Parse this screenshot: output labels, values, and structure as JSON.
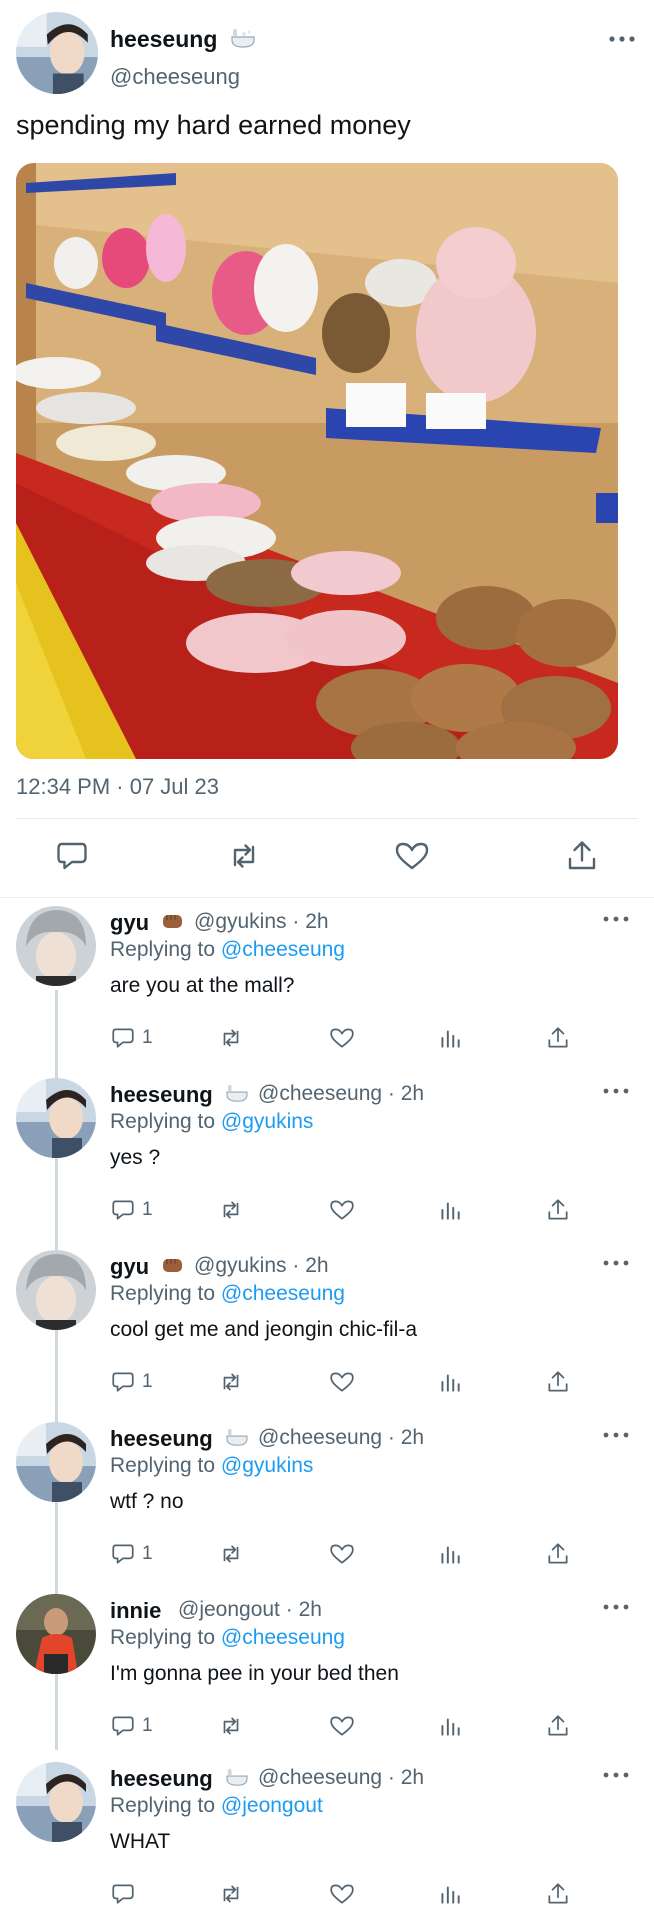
{
  "main_tweet": {
    "author_name": "heeseung",
    "author_handle": "@cheeseung",
    "text": "spending my hard earned money",
    "timestamp": "12:34 PM · 07 Jul 23",
    "icons": {
      "more": "more-dots-icon",
      "reply": "reply-bubble-icon",
      "retweet": "retweet-icon",
      "like": "heart-icon",
      "share": "share-upload-icon"
    }
  },
  "replies": [
    {
      "name": "gyu",
      "badge": "fist-emoji",
      "handle": "@gyukins",
      "time": "2h",
      "replying_to_label": "Replying to",
      "replying_to": "@cheeseung",
      "text": "are you at the mall?",
      "reply_count": "1"
    },
    {
      "name": "heeseung",
      "badge": "bathtub-emoji",
      "handle": "@cheeseung",
      "time": "2h",
      "replying_to_label": "Replying to",
      "replying_to": "@gyukins",
      "text": "yes ?",
      "reply_count": "1"
    },
    {
      "name": "gyu",
      "badge": "fist-emoji",
      "handle": "@gyukins",
      "time": "2h",
      "replying_to_label": "Replying to",
      "replying_to": "@cheeseung",
      "text": "cool get me and jeongin chic-fil-a",
      "reply_count": "1"
    },
    {
      "name": "heeseung",
      "badge": "bathtub-emoji",
      "handle": "@cheeseung",
      "time": "2h",
      "replying_to_label": "Replying to",
      "replying_to": "@gyukins",
      "text": "wtf ? no",
      "reply_count": "1"
    },
    {
      "name": "innie",
      "badge": "",
      "handle": "@jeongout",
      "time": "2h",
      "replying_to_label": "Replying to",
      "replying_to": "@cheeseung",
      "text": "I'm gonna pee in your bed then",
      "reply_count": "1"
    },
    {
      "name": "heeseung",
      "badge": "bathtub-emoji",
      "handle": "@cheeseung",
      "time": "2h",
      "replying_to_label": "Replying to",
      "replying_to": "@jeongout",
      "text": "WHAT",
      "reply_count": ""
    }
  ],
  "colors": {
    "text": "#0f1419",
    "secondary": "#536471",
    "link": "#1d9bf0",
    "divider": "#e7ecf0",
    "thread_line": "#cfd9de"
  }
}
